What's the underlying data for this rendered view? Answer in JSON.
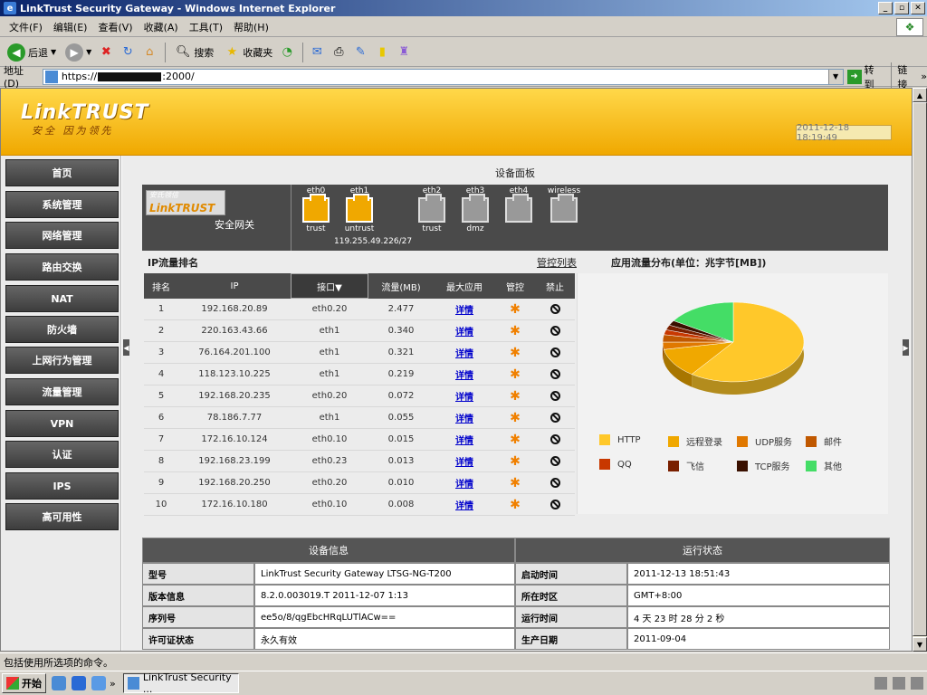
{
  "window": {
    "title": "LinkTrust Security Gateway - Windows Internet Explorer"
  },
  "menu": [
    "文件(F)",
    "编辑(E)",
    "查看(V)",
    "收藏(A)",
    "工具(T)",
    "帮助(H)"
  ],
  "toolbar": {
    "back": "后退",
    "search": "搜索",
    "favorites": "收藏夹"
  },
  "address": {
    "label": "地址(D)",
    "url_prefix": "https://",
    "url_suffix": ":2000/",
    "go": "转到",
    "links": "链接"
  },
  "header": {
    "logo": "LinkTRUST",
    "slogan": "安全 因为领先",
    "datetime": "2011-12-18 18:19:49"
  },
  "nav": [
    "首页",
    "系统管理",
    "网络管理",
    "路由交换",
    "NAT",
    "防火墙",
    "上网行为管理",
    "流量管理",
    "VPN",
    "认证",
    "IPS",
    "高可用性"
  ],
  "device": {
    "panel_title": "设备面板",
    "logo_top": "安氏领信",
    "logo": "LinkTRUST",
    "name": "安全网关",
    "ports": [
      {
        "name": "eth0",
        "zone": "trust",
        "active": true
      },
      {
        "name": "eth1",
        "zone": "untrust",
        "active": true
      },
      {
        "name": "eth2",
        "zone": "trust",
        "active": false
      },
      {
        "name": "eth3",
        "zone": "dmz",
        "active": false
      },
      {
        "name": "eth4",
        "zone": "",
        "active": false
      },
      {
        "name": "wireless",
        "zone": "",
        "active": false
      }
    ],
    "ip": "119.255.49.226/27"
  },
  "ranking": {
    "title": "IP流量排名",
    "control_list": "管控列表",
    "columns": [
      "排名",
      "IP",
      "接口▼",
      "流量(MB)",
      "最大应用",
      "管控",
      "禁止"
    ],
    "detail_label": "详情",
    "rows": [
      {
        "rank": "1",
        "ip": "192.168.20.89",
        "iface": "eth0.20",
        "traffic": "2.477"
      },
      {
        "rank": "2",
        "ip": "220.163.43.66",
        "iface": "eth1",
        "traffic": "0.340"
      },
      {
        "rank": "3",
        "ip": "76.164.201.100",
        "iface": "eth1",
        "traffic": "0.321"
      },
      {
        "rank": "4",
        "ip": "118.123.10.225",
        "iface": "eth1",
        "traffic": "0.219"
      },
      {
        "rank": "5",
        "ip": "192.168.20.235",
        "iface": "eth0.20",
        "traffic": "0.072"
      },
      {
        "rank": "6",
        "ip": "78.186.7.77",
        "iface": "eth1",
        "traffic": "0.055"
      },
      {
        "rank": "7",
        "ip": "172.16.10.124",
        "iface": "eth0.10",
        "traffic": "0.015"
      },
      {
        "rank": "8",
        "ip": "192.168.23.199",
        "iface": "eth0.23",
        "traffic": "0.013"
      },
      {
        "rank": "9",
        "ip": "192.168.20.250",
        "iface": "eth0.20",
        "traffic": "0.010"
      },
      {
        "rank": "10",
        "ip": "172.16.10.180",
        "iface": "eth0.10",
        "traffic": "0.008"
      }
    ]
  },
  "chart_data": {
    "type": "pie",
    "title": "应用流量分布(单位：兆字节[MB])",
    "categories": [
      "HTTP",
      "远程登录",
      "UDP服务",
      "邮件",
      "QQ",
      "飞信",
      "TCP服务",
      "其他"
    ],
    "values": [
      60,
      12,
      3,
      3,
      2,
      2,
      2,
      16
    ],
    "colors": [
      "#ffc82a",
      "#f0a800",
      "#e07800",
      "#c05800",
      "#c83800",
      "#7a2000",
      "#3a1000",
      "#44dd66"
    ],
    "legend": "bottom"
  },
  "info": {
    "left_title": "设备信息",
    "right_title": "运行状态",
    "rows": [
      {
        "k1": "型号",
        "v1": "LinkTrust Security Gateway LTSG-NG-T200",
        "k2": "启动时间",
        "v2": "2011-12-13 18:51:43"
      },
      {
        "k1": "版本信息",
        "v1": "8.2.0.003019.T 2011-12-07 1:13",
        "k2": "所在时区",
        "v2": "GMT+8:00"
      },
      {
        "k1": "序列号",
        "v1": "ee5o/8/qgEbcHRqLUTlACw==",
        "k2": "运行时间",
        "v2": "4 天 23 时 28 分 2 秒"
      },
      {
        "k1": "许可证状态",
        "v1": "永久有效",
        "k2": "生产日期",
        "v2": "2011-09-04"
      }
    ]
  },
  "status": {
    "text": "包括使用所选项的命令。"
  },
  "taskbar": {
    "start": "开始",
    "item": "LinkTrust Security ..."
  }
}
